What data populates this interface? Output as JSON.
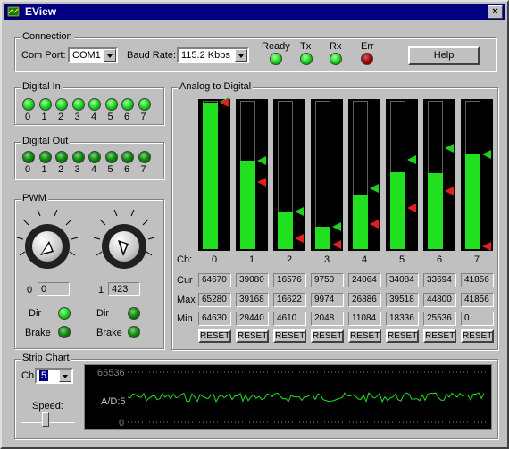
{
  "window": {
    "title": "EView",
    "close_label": "×"
  },
  "connection": {
    "group_label": "Connection",
    "com_port_label": "Com Port:",
    "com_port_value": "COM1",
    "baud_label": "Baud Rate:",
    "baud_value": "115.2 Kbps",
    "indicators": [
      {
        "label": "Ready",
        "state": "on"
      },
      {
        "label": "Tx",
        "state": "on"
      },
      {
        "label": "Rx",
        "state": "on"
      },
      {
        "label": "Err",
        "state": "red"
      }
    ],
    "help_label": "Help"
  },
  "digital_in": {
    "group_label": "Digital In",
    "channels": [
      "0",
      "1",
      "2",
      "3",
      "4",
      "5",
      "6",
      "7"
    ],
    "states": [
      "on",
      "on",
      "on",
      "on",
      "on",
      "on",
      "on",
      "on"
    ]
  },
  "digital_out": {
    "group_label": "Digital Out",
    "channels": [
      "0",
      "1",
      "2",
      "3",
      "4",
      "5",
      "6",
      "7"
    ],
    "states": [
      "dark",
      "dark",
      "dark",
      "dark",
      "dark",
      "dark",
      "dark",
      "dark"
    ]
  },
  "pwm": {
    "group_label": "PWM",
    "channels": [
      {
        "index": "0",
        "value": "0",
        "dir_label": "Dir",
        "brake_label": "Brake"
      },
      {
        "index": "1",
        "value": "423",
        "dir_label": "Dir",
        "brake_label": "Brake"
      }
    ]
  },
  "adc": {
    "group_label": "Analog to Digital",
    "ch_label": "Ch:",
    "cur_label": "Cur",
    "max_label": "Max",
    "min_label": "Min",
    "reset_label": "RESET",
    "full_scale": 65536,
    "channels": [
      {
        "ch": "0",
        "cur": "64670",
        "max": "65280",
        "min": "64630"
      },
      {
        "ch": "1",
        "cur": "39080",
        "max": "39168",
        "min": "29440"
      },
      {
        "ch": "2",
        "cur": "16576",
        "max": "16622",
        "min": "4610"
      },
      {
        "ch": "3",
        "cur": "9750",
        "max": "9974",
        "min": "2048"
      },
      {
        "ch": "4",
        "cur": "24064",
        "max": "26886",
        "min": "11084"
      },
      {
        "ch": "5",
        "cur": "34084",
        "max": "39518",
        "min": "18336"
      },
      {
        "ch": "6",
        "cur": "33694",
        "max": "44800",
        "min": "25536"
      },
      {
        "ch": "7",
        "cur": "41856",
        "max": "41856",
        "min": "0"
      }
    ]
  },
  "strip_chart": {
    "group_label": "Strip Chart",
    "ch_label": "Ch:",
    "ch_value": "5",
    "speed_label": "Speed:",
    "y_max": "65536",
    "y_min": "0",
    "series_label": "A/D:5",
    "speed_fraction": 0.45
  }
}
